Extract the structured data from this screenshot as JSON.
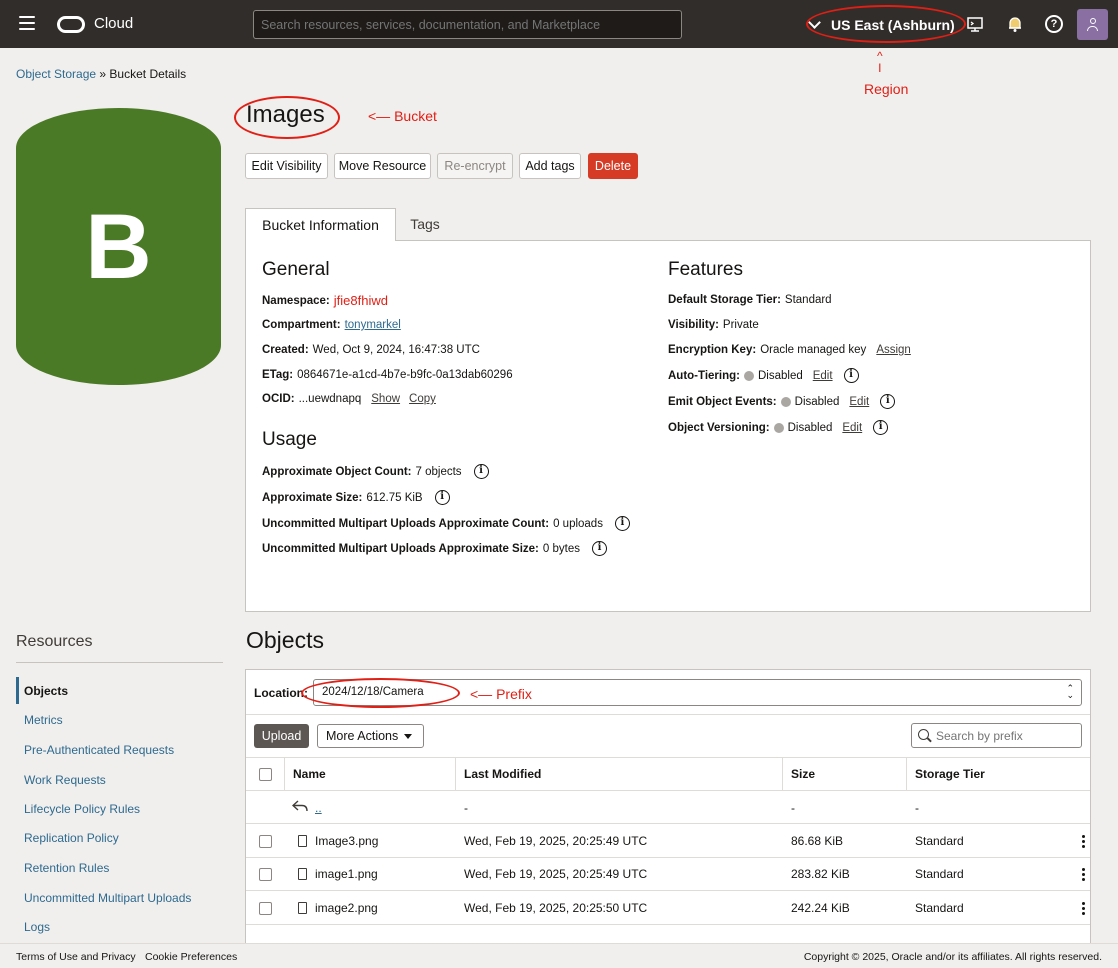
{
  "topbar": {
    "brand": "Cloud",
    "search_placeholder": "Search resources, services, documentation, and Marketplace",
    "region": "US East (Ashburn)",
    "help_glyph": "?"
  },
  "annotations": {
    "region_label": "Region",
    "region_arrow": "^\nI",
    "bucket_label": "<— Bucket",
    "prefix_label": "<— Prefix"
  },
  "breadcrumb": {
    "root": "Object Storage",
    "separator": "»",
    "current": "Bucket Details"
  },
  "bucket": {
    "letter": "B",
    "icon_color": "#4a7a26",
    "name": "Images"
  },
  "actions": {
    "edit_visibility": "Edit Visibility",
    "move_resource": "Move Resource",
    "re_encrypt": "Re-encrypt",
    "add_tags": "Add tags",
    "delete": "Delete"
  },
  "tabs": {
    "info": "Bucket Information",
    "tags": "Tags"
  },
  "general": {
    "heading": "General",
    "namespace_label": "Namespace:",
    "namespace": "jfie8fhiwd",
    "compartment_label": "Compartment:",
    "compartment": "tonymarkel",
    "created_label": "Created:",
    "created": "Wed, Oct 9, 2024, 16:47:38 UTC",
    "etag_label": "ETag:",
    "etag": "0864671e-a1cd-4b7e-b9fc-0a13dab60296",
    "ocid_label": "OCID:",
    "ocid": "...uewdnapq",
    "show": "Show",
    "copy": "Copy"
  },
  "usage": {
    "heading": "Usage",
    "count_label": "Approximate Object Count:",
    "count": "7 objects",
    "size_label": "Approximate Size:",
    "size": "612.75 KiB",
    "mp_count_label": "Uncommitted Multipart Uploads Approximate Count:",
    "mp_count": "0 uploads",
    "mp_size_label": "Uncommitted Multipart Uploads Approximate Size:",
    "mp_size": "0 bytes"
  },
  "features": {
    "heading": "Features",
    "tier_label": "Default Storage Tier:",
    "tier": "Standard",
    "visibility_label": "Visibility:",
    "visibility": "Private",
    "encryption_label": "Encryption Key:",
    "encryption": "Oracle managed key",
    "assign": "Assign",
    "autotier_label": "Auto-Tiering:",
    "autotier": "Disabled",
    "events_label": "Emit Object Events:",
    "events": "Disabled",
    "versioning_label": "Object Versioning:",
    "versioning": "Disabled",
    "edit": "Edit",
    "info_glyph": "i"
  },
  "resources": {
    "title": "Resources",
    "items": [
      "Objects",
      "Metrics",
      "Pre-Authenticated Requests",
      "Work Requests",
      "Lifecycle Policy Rules",
      "Replication Policy",
      "Retention Rules",
      "Uncommitted Multipart Uploads",
      "Logs"
    ]
  },
  "objects": {
    "title": "Objects",
    "location_label": "Location:",
    "location": "2024/12/18/Camera",
    "upload": "Upload",
    "more_actions": "More Actions",
    "search_placeholder": "Search by prefix",
    "columns": [
      "Name",
      "Last Modified",
      "Size",
      "Storage Tier"
    ],
    "parent": {
      "name": "..",
      "modified": "-",
      "size": "-",
      "tier": "-"
    },
    "rows": [
      {
        "name": "Image3.png",
        "modified": "Wed, Feb 19, 2025, 20:25:49 UTC",
        "size": "86.68 KiB",
        "tier": "Standard"
      },
      {
        "name": "image1.png",
        "modified": "Wed, Feb 19, 2025, 20:25:49 UTC",
        "size": "283.82 KiB",
        "tier": "Standard"
      },
      {
        "name": "image2.png",
        "modified": "Wed, Feb 19, 2025, 20:25:50 UTC",
        "size": "242.24 KiB",
        "tier": "Standard"
      }
    ]
  },
  "footer": {
    "terms": "Terms of Use and Privacy",
    "cookies": "Cookie Preferences",
    "copyright": "Copyright © 2025, Oracle and/or its affiliates. All rights reserved."
  }
}
